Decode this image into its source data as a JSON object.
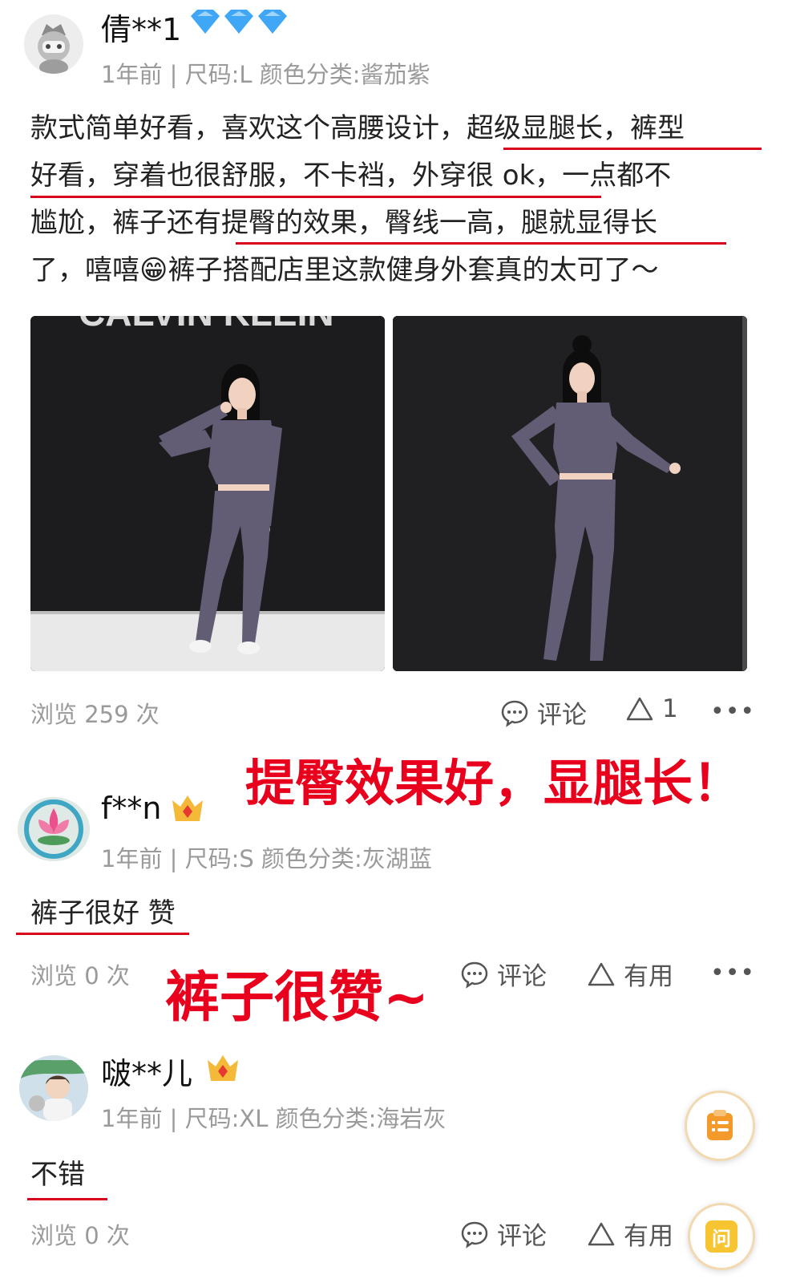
{
  "review1": {
    "username": "倩**1",
    "meta": "1年前 | 尺码:L 颜色分类:酱茄紫",
    "text_lines": [
      "款式简单好看，喜欢这个高腰设计，超级显腿长，裤型",
      "好看，穿着也很舒服，不卡裆，外穿很 ok，一点都不",
      "尴尬，裤子还有提臀的效果，臀线一高，腿就显得长",
      "了，嘻嘻😁裤子搭配店里这款健身外套真的太可了～"
    ],
    "photo_wall_text": "CALVIN KLEIN",
    "views": "浏览 259 次",
    "comment_label": "评论",
    "like_label": "1",
    "more_label": "•••"
  },
  "annotation1": "提臀效果好，显腿长！",
  "review2": {
    "username": "f**n",
    "meta": "1年前 | 尺码:S 颜色分类:灰湖蓝",
    "text": "裤子很好 赞",
    "views": "浏览 0 次",
    "comment_label": "评论",
    "useful_label": "有用",
    "more_label": "•••"
  },
  "annotation2": "裤子很赞~",
  "review3": {
    "username": "啵**儿",
    "meta": "1年前 | 尺码:XL 颜色分类:海岩灰",
    "text": "不错",
    "views": "浏览 0 次",
    "comment_label": "评论",
    "useful_label": "有用"
  },
  "float_ask_label": "问",
  "colors": {
    "annotation_red": "#e8001c",
    "underline_red": "#d8001a",
    "meta_gray": "#9a9a9a",
    "diamond_blue": "#3fa7f5",
    "crown_gold": "#f5b93a",
    "outfit_purple": "#625d74"
  }
}
